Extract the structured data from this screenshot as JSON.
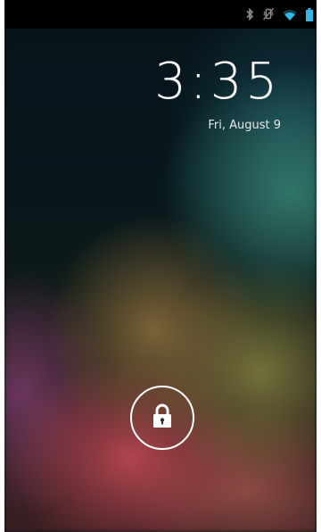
{
  "status_bar": {
    "icons": [
      "bluetooth-icon",
      "vibrate-icon",
      "wifi-icon",
      "battery-icon"
    ],
    "icon_color": "#33b5e5"
  },
  "lockscreen": {
    "time": "3:35",
    "date": "Fri, August 9",
    "unlock_icon": "lock-icon"
  }
}
